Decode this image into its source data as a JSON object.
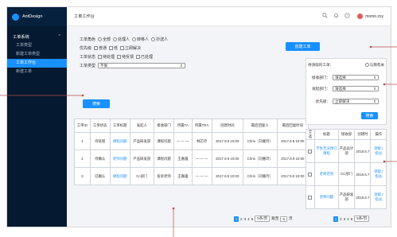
{
  "app": {
    "logo": "AntDesign"
  },
  "sidebar": {
    "group": "工单系统",
    "items": [
      {
        "label": "工单类型",
        "active": false
      },
      {
        "label": "新建工单类型",
        "active": false
      },
      {
        "label": "工单工作台",
        "active": true
      },
      {
        "label": "新建工单",
        "active": false
      }
    ]
  },
  "topbar": {
    "title": "工单工作台",
    "username": "momo.zxy",
    "icons": [
      "search-icon",
      "bell-icon",
      "question-icon"
    ]
  },
  "filters": {
    "role": {
      "label": "工单角色",
      "options": [
        "全部",
        "处理人",
        "转移人",
        "抄送人"
      ]
    },
    "priority": {
      "label": "优先级",
      "options": [
        "普通",
        "低",
        "立即解决"
      ]
    },
    "status": {
      "label": "工单状态",
      "options": [
        "待处理",
        "待反馈",
        "已处理"
      ]
    },
    "type": {
      "label": "工单类型",
      "value": "不限"
    }
  },
  "search_button": "搜索",
  "table": {
    "headers": [
      "工单ID",
      "工单状态",
      "工单标题",
      "发起人",
      "接收部门",
      "所属TA",
      "所属TRA",
      "创建时间",
      "最后回复人",
      "最后回复时间"
    ],
    "rows": [
      [
        "1",
        "待处理",
        "课程问题",
        "产品研发部",
        "课程问题",
        "— — —",
        "林芯玲",
        "2017.9.9 10:00",
        "Chris（刘嘉玲）",
        "2017.9.9 10:00"
      ],
      [
        "2",
        "待确认",
        "老师问题",
        "产品研发部",
        "课程问题",
        "王嘉蕴",
        "— — —",
        "2017.9.9 10:00",
        "Chris（刘嘉玲）",
        "2017.9.9 10:00"
      ],
      [
        "3",
        "已确认",
        "课程问题",
        "Cc部门",
        "投诉老师",
        "王嘉蕴",
        "— — —",
        "2017.9.9 10:00",
        "Chris（刘嘉玲）",
        "2017.9.9 10:00"
      ]
    ]
  },
  "pager": {
    "current": "1",
    "pages": [
      "2",
      "3",
      "4",
      "5"
    ],
    "page_size": "5条/页",
    "jump_label": "跳至",
    "jump_value": "5",
    "page_unit": "页"
  },
  "create_button": "创建工单",
  "right_panel": {
    "title": "待领取的工单：",
    "toggle": "与我有关",
    "fields": [
      {
        "label": "接收部门：",
        "value": "请选择"
      },
      {
        "label": "发起部门：",
        "value": "请选择"
      },
      {
        "label": "优先级：",
        "value": "立即解决"
      }
    ],
    "search": "搜索"
  },
  "right_table": {
    "headers": [
      "全选",
      "标题",
      "接收部",
      "创建时",
      "操作"
    ],
    "rows": [
      [
        "学生无法预订课程",
        "产品设计部",
        "2018.6.7",
        "领取 | 指派"
      ],
      [
        "老师迟到",
        "CC部门",
        "2018.6.7",
        "领取 | 指派"
      ],
      [
        "老师问题",
        "产品研发部",
        "2018.6.7",
        "领取 | 指派"
      ]
    ]
  },
  "right_pager": {
    "current": "1",
    "pages": [
      "2",
      "3",
      "4",
      "5"
    ],
    "page_size": "5条/页"
  }
}
